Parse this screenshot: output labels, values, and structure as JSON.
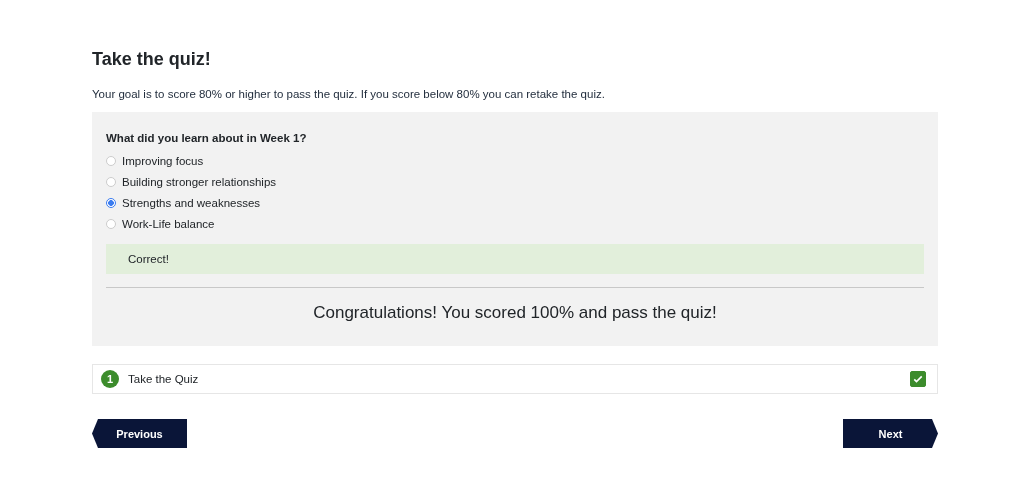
{
  "title": "Take the quiz!",
  "intro": "Your goal is to score 80% or higher to pass the quiz. If you score below 80% you can retake the quiz.",
  "quiz": {
    "question": "What did you learn about in Week 1?",
    "options": [
      {
        "label": "Improving focus",
        "selected": false
      },
      {
        "label": "Building stronger relationships",
        "selected": false
      },
      {
        "label": "Strengths and weaknesses",
        "selected": true
      },
      {
        "label": "Work-Life balance",
        "selected": false
      }
    ],
    "feedback": "Correct!",
    "result": "Congratulations! You scored 100% and pass the quiz!"
  },
  "steps": [
    {
      "number": "1",
      "label": "Take the Quiz",
      "checked": true
    }
  ],
  "buttons": {
    "previous": "Previous",
    "next": "Next"
  }
}
